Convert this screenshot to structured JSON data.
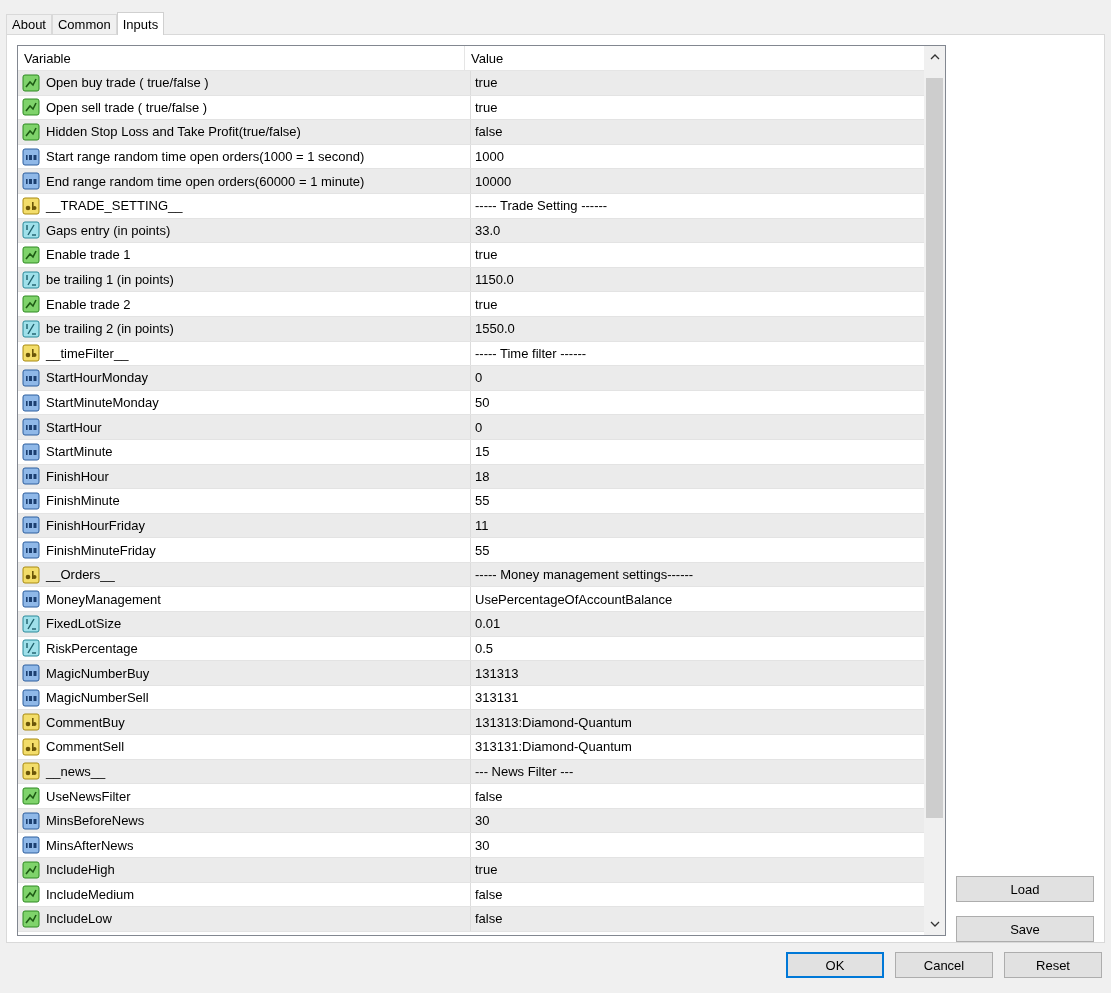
{
  "tabs": [
    {
      "label": "About",
      "selected": false
    },
    {
      "label": "Common",
      "selected": false
    },
    {
      "label": "Inputs",
      "selected": true
    }
  ],
  "table": {
    "columns": [
      "Variable",
      "Value"
    ],
    "rows": [
      {
        "kind": "bool",
        "variable": "Open buy trade ( true/false )",
        "value": "true"
      },
      {
        "kind": "bool",
        "variable": "Open sell trade ( true/false )",
        "value": "true"
      },
      {
        "kind": "bool",
        "variable": "Hidden Stop Loss and Take Profit(true/false)",
        "value": "false"
      },
      {
        "kind": "int",
        "variable": "Start range random time open orders(1000 = 1 second)",
        "value": "1000"
      },
      {
        "kind": "int",
        "variable": "End range random time open orders(60000 = 1 minute)",
        "value": "10000"
      },
      {
        "kind": "string",
        "variable": "__TRADE_SETTING__",
        "value": "----- Trade Setting ------"
      },
      {
        "kind": "double",
        "variable": "Gaps entry (in points)",
        "value": "33.0"
      },
      {
        "kind": "bool",
        "variable": "Enable trade 1",
        "value": "true"
      },
      {
        "kind": "double",
        "variable": "be trailing 1 (in points)",
        "value": "1150.0"
      },
      {
        "kind": "bool",
        "variable": "Enable trade 2",
        "value": "true"
      },
      {
        "kind": "double",
        "variable": "be trailing 2 (in points)",
        "value": "1550.0"
      },
      {
        "kind": "string",
        "variable": "__timeFilter__",
        "value": "----- Time filter ------"
      },
      {
        "kind": "int",
        "variable": "StartHourMonday",
        "value": "0"
      },
      {
        "kind": "int",
        "variable": "StartMinuteMonday",
        "value": "50"
      },
      {
        "kind": "int",
        "variable": "StartHour",
        "value": "0"
      },
      {
        "kind": "int",
        "variable": "StartMinute",
        "value": "15"
      },
      {
        "kind": "int",
        "variable": "FinishHour",
        "value": "18"
      },
      {
        "kind": "int",
        "variable": "FinishMinute",
        "value": "55"
      },
      {
        "kind": "int",
        "variable": "FinishHourFriday",
        "value": "11"
      },
      {
        "kind": "int",
        "variable": "FinishMinuteFriday",
        "value": "55"
      },
      {
        "kind": "string",
        "variable": "__Orders__",
        "value": "----- Money management settings------"
      },
      {
        "kind": "int",
        "variable": "MoneyManagement",
        "value": "UsePercentageOfAccountBalance"
      },
      {
        "kind": "double",
        "variable": "FixedLotSize",
        "value": "0.01"
      },
      {
        "kind": "double",
        "variable": "RiskPercentage",
        "value": "0.5"
      },
      {
        "kind": "int",
        "variable": "MagicNumberBuy",
        "value": "131313"
      },
      {
        "kind": "int",
        "variable": "MagicNumberSell",
        "value": "313131"
      },
      {
        "kind": "string",
        "variable": "CommentBuy",
        "value": "131313:Diamond-Quantum"
      },
      {
        "kind": "string",
        "variable": "CommentSell",
        "value": "313131:Diamond-Quantum"
      },
      {
        "kind": "string",
        "variable": "__news__",
        "value": "--- News Filter ---"
      },
      {
        "kind": "bool",
        "variable": "UseNewsFilter",
        "value": "false"
      },
      {
        "kind": "int",
        "variable": "MinsBeforeNews",
        "value": "30"
      },
      {
        "kind": "int",
        "variable": "MinsAfterNews",
        "value": "30"
      },
      {
        "kind": "bool",
        "variable": "IncludeHigh",
        "value": "true"
      },
      {
        "kind": "bool",
        "variable": "IncludeMedium",
        "value": "false"
      },
      {
        "kind": "bool",
        "variable": "IncludeLow",
        "value": "false"
      }
    ]
  },
  "side_buttons": [
    "Load",
    "Save"
  ],
  "buttons": [
    {
      "label": "OK",
      "default": true
    },
    {
      "label": "Cancel",
      "default": false
    },
    {
      "label": "Reset",
      "default": false
    }
  ]
}
